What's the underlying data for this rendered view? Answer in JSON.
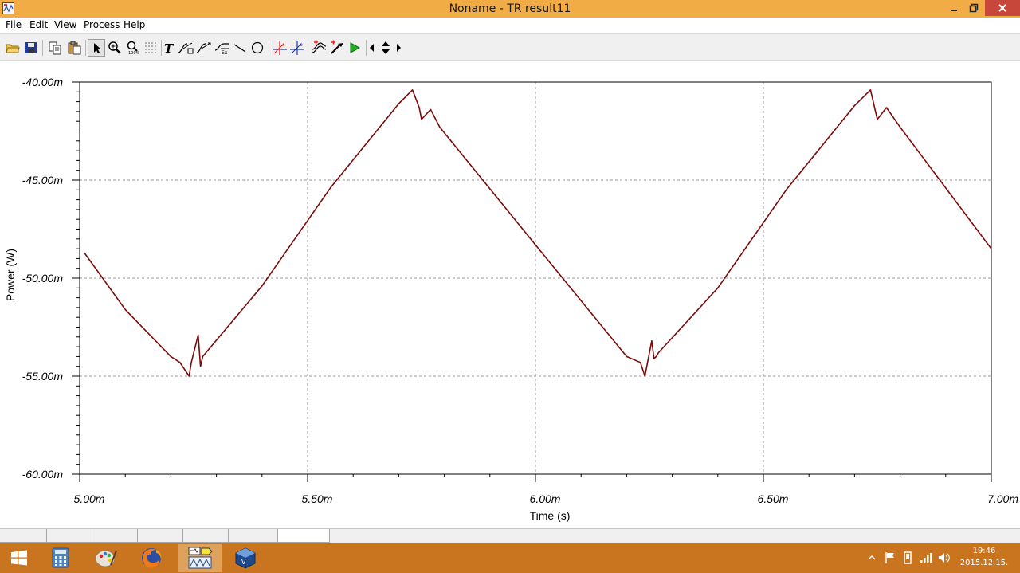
{
  "window": {
    "title": "Noname - TR result11",
    "icon": "tina-app-icon",
    "controls": [
      "minimize-icon",
      "restore-icon",
      "close-icon"
    ]
  },
  "menu": {
    "items": [
      {
        "label": "File"
      },
      {
        "label": "Edit"
      },
      {
        "label": "View"
      },
      {
        "label": "Process"
      },
      {
        "label": "Help"
      }
    ]
  },
  "toolbar": {
    "buttons": [
      "open-folder-icon",
      "save-icon",
      "copy-icon",
      "paste-icon",
      "pointer-icon",
      "zoom-in-icon",
      "zoom-100-icon",
      "grid-icon",
      "text-icon",
      "curve-label-icon",
      "curve-label-2-icon",
      "curve-label-3-icon",
      "line-icon",
      "circle-icon",
      "cursor-a-icon",
      "cursor-b-icon",
      "add-trace-icon",
      "probe-icon",
      "run-icon",
      "arrow-left-icon",
      "arrow-updown-icon",
      "arrow-right-icon"
    ],
    "active": "pointer-icon"
  },
  "chart_data": {
    "type": "line",
    "xlabel": "Time (s)",
    "ylabel": "Power (W)",
    "xlim": [
      5.0,
      7.0
    ],
    "ylim": [
      -60.0,
      -40.0
    ],
    "x_ticks": [
      "5.00m",
      "5.50m",
      "6.00m",
      "6.50m",
      "7.00m"
    ],
    "y_ticks": [
      "-40.00m",
      "-45.00m",
      "-50.00m",
      "-55.00m",
      "-60.00m"
    ],
    "x_unit_note": "ms",
    "grid": true,
    "line_color": "#7a0a0a",
    "series": [
      {
        "x": [
          5.01,
          5.1,
          5.2,
          5.22,
          5.24,
          5.245,
          5.26,
          5.265,
          5.27,
          5.4,
          5.55,
          5.7,
          5.73,
          5.745,
          5.75,
          5.77,
          5.79,
          6.0,
          6.2,
          6.23,
          6.24,
          6.255,
          6.26,
          6.265,
          6.27,
          6.4,
          6.55,
          6.7,
          6.735,
          6.745,
          6.75,
          6.77,
          6.8,
          7.0
        ],
        "y": [
          -48.7,
          -51.6,
          -54.0,
          -54.3,
          -55.0,
          -54.3,
          -52.9,
          -54.5,
          -54.0,
          -50.4,
          -45.4,
          -41.1,
          -40.4,
          -41.3,
          -41.9,
          -41.4,
          -42.3,
          -48.3,
          -54.0,
          -54.3,
          -55.0,
          -53.2,
          -54.1,
          -54.0,
          -53.8,
          -50.5,
          -45.5,
          -41.2,
          -40.4,
          -41.4,
          -41.9,
          -41.3,
          -42.3,
          -48.5
        ]
      }
    ]
  },
  "bottom_tabs": 7,
  "taskbar": {
    "apps": [
      "windows-start-icon",
      "calculator-icon",
      "paint-icon",
      "firefox-icon",
      "tina-circuit-icon",
      "virtualbox-icon"
    ],
    "active_app": "tina-circuit-icon",
    "tray": [
      "show-hidden-icon",
      "flag-icon",
      "device-icon",
      "signal-icon",
      "volume-icon"
    ],
    "time": "19:46",
    "date": "2015.12.15."
  },
  "colors": {
    "titlebar": "#f1ac46",
    "taskbar": "#c9751f",
    "close": "#c7483b",
    "trace": "#7a0a0a"
  }
}
